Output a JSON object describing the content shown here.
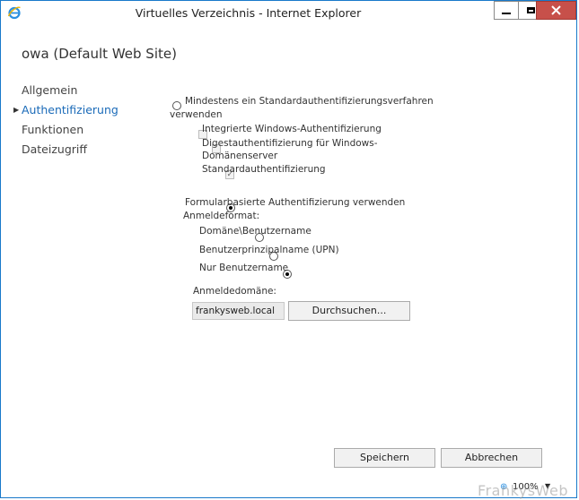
{
  "window": {
    "title": "Virtuelles Verzeichnis - Internet Explorer",
    "controls": {
      "minimize": "minimize-icon",
      "maximize": "maximize-icon",
      "close": "close-icon"
    }
  },
  "page": {
    "heading": "owa (Default Web Site)"
  },
  "nav": {
    "items": [
      {
        "label": "Allgemein",
        "active": false
      },
      {
        "label": "Authentifizierung",
        "active": true
      },
      {
        "label": "Funktionen",
        "active": false
      },
      {
        "label": "Dateizugriff",
        "active": false
      }
    ]
  },
  "auth": {
    "standard_radio": {
      "label_line1": "Mindestens ein Standardauthentifizierungsverfahren",
      "label_line2": "verwenden",
      "selected": false
    },
    "methods": [
      {
        "label": "Integrierte Windows-Authentifizierung",
        "checked": false
      },
      {
        "label_line1": "Digestauthentifizierung für Windows-",
        "label_line2": "Domänenserver",
        "checked": false
      },
      {
        "label": "Standardauthentifizierung",
        "checked": true
      }
    ],
    "forms_radio": {
      "label": "Formularbasierte Authentifizierung verwenden",
      "selected": true
    },
    "logon_format_label": "Anmeldeformat:",
    "logon_formats": [
      {
        "label": "Domäne\\Benutzername",
        "selected": false
      },
      {
        "label": "Benutzerprinzipalname (UPN)",
        "selected": false
      },
      {
        "label": "Nur Benutzername",
        "selected": true
      }
    ],
    "domain_label": "Anmeldedomäne:",
    "domain_value": "frankysweb.local",
    "browse_label": "Durchsuchen..."
  },
  "footer": {
    "save_label": "Speichern",
    "cancel_label": "Abbrechen"
  },
  "statusbar": {
    "zoom": "100%"
  },
  "watermark": "FrankysWeb"
}
